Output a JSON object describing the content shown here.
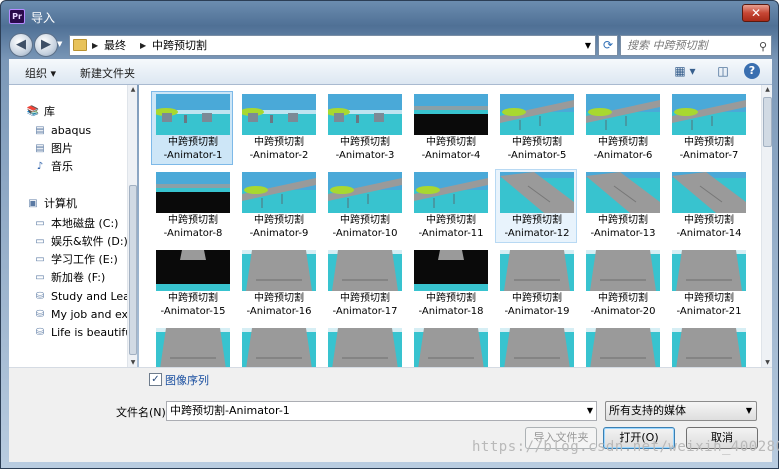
{
  "window": {
    "title": "导入",
    "app_badge": "Pr",
    "close_glyph": "✕"
  },
  "nav": {
    "back_glyph": "◀",
    "forward_glyph": "▶",
    "breadcrumb": [
      "最终",
      "中跨预切割"
    ],
    "refresh_glyph": "⟳",
    "search_placeholder": "搜索 中跨预切割",
    "search_glyph": "⚲"
  },
  "toolbar": {
    "organize": "组织 ▾",
    "new_folder": "新建文件夹",
    "view_glyph": "▦ ▾",
    "pane_glyph": "◫",
    "help_glyph": "?"
  },
  "sidebar": {
    "items": [
      {
        "label": "库",
        "icon": "library-icon",
        "glyph": "📚",
        "indent": 0
      },
      {
        "label": "abaqus",
        "icon": "library-folder-icon",
        "glyph": "▤",
        "indent": 1
      },
      {
        "label": "图片",
        "icon": "pictures-icon",
        "glyph": "▤",
        "indent": 1
      },
      {
        "label": "音乐",
        "icon": "music-icon",
        "glyph": "♪",
        "indent": 1
      },
      {
        "label": "计算机",
        "icon": "computer-icon",
        "glyph": "▣",
        "indent": 0
      },
      {
        "label": "本地磁盘 (C:)",
        "icon": "system-drive-icon",
        "glyph": "▭",
        "indent": 1
      },
      {
        "label": "娱乐&软件 (D:)",
        "icon": "drive-icon",
        "glyph": "▭",
        "indent": 1
      },
      {
        "label": "学习工作 (E:)",
        "icon": "drive-icon",
        "glyph": "▭",
        "indent": 1
      },
      {
        "label": "新加卷 (F:)",
        "icon": "drive-icon",
        "glyph": "▭",
        "indent": 1
      },
      {
        "label": "Study and Learn",
        "icon": "network-drive-icon",
        "glyph": "⛁",
        "indent": 1
      },
      {
        "label": "My job and exp",
        "icon": "network-drive-icon",
        "glyph": "⛁",
        "indent": 1
      },
      {
        "label": "Life is beautiful",
        "icon": "network-drive-icon",
        "glyph": "⛁",
        "indent": 1
      }
    ]
  },
  "files": {
    "name_prefix": "中跨预切割",
    "items": [
      {
        "line1": "中跨预切割",
        "line2": "-Animator-1",
        "state": "selected",
        "thumb": "bridge-side"
      },
      {
        "line1": "中跨预切割",
        "line2": "-Animator-2",
        "state": "",
        "thumb": "bridge-side"
      },
      {
        "line1": "中跨预切割",
        "line2": "-Animator-3",
        "state": "",
        "thumb": "bridge-side"
      },
      {
        "line1": "中跨预切割",
        "line2": "-Animator-4",
        "state": "",
        "thumb": "dark-low"
      },
      {
        "line1": "中跨预切割",
        "line2": "-Animator-5",
        "state": "",
        "thumb": "deck-angle"
      },
      {
        "line1": "中跨预切割",
        "line2": "-Animator-6",
        "state": "",
        "thumb": "deck-angle"
      },
      {
        "line1": "中跨预切割",
        "line2": "-Animator-7",
        "state": "",
        "thumb": "deck-angle"
      },
      {
        "line1": "中跨预切割",
        "line2": "-Animator-8",
        "state": "",
        "thumb": "dark-low"
      },
      {
        "line1": "中跨预切割",
        "line2": "-Animator-9",
        "state": "",
        "thumb": "deck-angle"
      },
      {
        "line1": "中跨预切割",
        "line2": "-Animator-10",
        "state": "",
        "thumb": "deck-angle"
      },
      {
        "line1": "中跨预切割",
        "line2": "-Animator-11",
        "state": "",
        "thumb": "deck-angle"
      },
      {
        "line1": "中跨预切割",
        "line2": "-Animator-12",
        "state": "hover",
        "thumb": "deck-diag"
      },
      {
        "line1": "中跨预切割",
        "line2": "-Animator-13",
        "state": "",
        "thumb": "deck-diag"
      },
      {
        "line1": "中跨预切割",
        "line2": "-Animator-14",
        "state": "",
        "thumb": "deck-diag"
      },
      {
        "line1": "中跨预切割",
        "line2": "-Animator-15",
        "state": "",
        "thumb": "dark-top"
      },
      {
        "line1": "中跨预切割",
        "line2": "-Animator-16",
        "state": "",
        "thumb": "deck-front"
      },
      {
        "line1": "中跨预切割",
        "line2": "-Animator-17",
        "state": "",
        "thumb": "deck-front"
      },
      {
        "line1": "中跨预切割",
        "line2": "-Animator-18",
        "state": "",
        "thumb": "dark-top"
      },
      {
        "line1": "中跨预切割",
        "line2": "-Animator-19",
        "state": "",
        "thumb": "deck-front"
      },
      {
        "line1": "中跨预切割",
        "line2": "-Animator-20",
        "state": "",
        "thumb": "deck-front"
      },
      {
        "line1": "中跨预切割",
        "line2": "-Animator-21",
        "state": "",
        "thumb": "deck-front"
      },
      {
        "line1": "",
        "line2": "",
        "state": "",
        "thumb": "deck-front"
      },
      {
        "line1": "",
        "line2": "",
        "state": "",
        "thumb": "deck-front"
      },
      {
        "line1": "",
        "line2": "",
        "state": "",
        "thumb": "deck-front"
      },
      {
        "line1": "",
        "line2": "",
        "state": "",
        "thumb": "deck-front"
      },
      {
        "line1": "",
        "line2": "",
        "state": "",
        "thumb": "deck-front"
      },
      {
        "line1": "",
        "line2": "",
        "state": "",
        "thumb": "deck-front"
      },
      {
        "line1": "",
        "line2": "",
        "state": "",
        "thumb": "deck-front"
      }
    ]
  },
  "bottom": {
    "image_sequence_label": "图像序列",
    "image_sequence_checked": "✓",
    "filename_label": "文件名(N):",
    "filename_value": "中跨预切割-Animator-1",
    "filter_value": "所有支持的媒体",
    "import_folder": "导入文件夹",
    "open": "打开(O)",
    "cancel": "取消"
  },
  "watermark": "https://blog.csdn.net/weixin_40028030",
  "colors": {
    "water": "#38c3cf",
    "deck": "#9a9a9a",
    "sky": "#4aa9d8",
    "dark": "#0a0a0a",
    "grass": "#a8d830"
  }
}
